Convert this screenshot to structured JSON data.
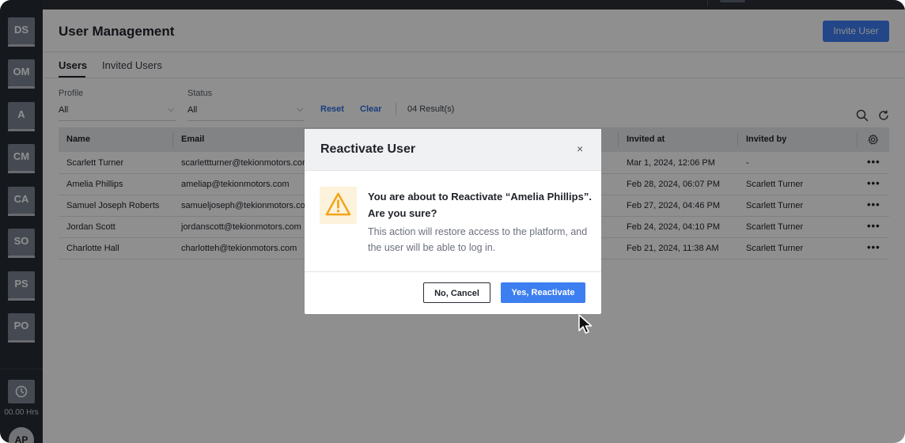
{
  "sidebar": {
    "items": [
      {
        "label": "DS"
      },
      {
        "label": "OM"
      },
      {
        "label": "A"
      },
      {
        "label": "CM"
      },
      {
        "label": "CA"
      },
      {
        "label": "SO"
      },
      {
        "label": "PS"
      },
      {
        "label": "PO"
      }
    ],
    "timer_label": "00.00 Hrs",
    "avatar_label": "AP"
  },
  "header": {
    "title": "User Management",
    "invite_button": "Invite User"
  },
  "tabs": [
    {
      "label": "Users",
      "active": true
    },
    {
      "label": "Invited Users",
      "active": false
    }
  ],
  "filters": {
    "profile": {
      "label": "Profile",
      "value": "All"
    },
    "status": {
      "label": "Status",
      "value": "All"
    },
    "reset": "Reset",
    "clear": "Clear",
    "results": "04 Result(s)"
  },
  "table": {
    "columns": [
      "Name",
      "Email",
      "Invited at",
      "Invited by"
    ],
    "rows": [
      {
        "name": "Scarlett Turner",
        "email": "scarlettturner@tekionmotors.com",
        "invited_at": "Mar 1, 2024, 12:06 PM",
        "invited_by": "-"
      },
      {
        "name": "Amelia Phillips",
        "email": "ameliap@tekionmotors.com",
        "invited_at": "Feb 28, 2024, 06:07 PM",
        "invited_by": "Scarlett Turner"
      },
      {
        "name": "Samuel Joseph Roberts",
        "email": "samueljoseph@tekionmotors.com",
        "invited_at": "Feb 27, 2024, 04:46 PM",
        "invited_by": "Scarlett Turner"
      },
      {
        "name": "Jordan Scott",
        "email": "jordanscott@tekionmotors.com",
        "invited_at": "Feb 24, 2024, 04:10 PM",
        "invited_by": "Scarlett Turner"
      },
      {
        "name": "Charlotte Hall",
        "email": "charlotteh@tekionmotors.com",
        "invited_at": "Feb 21, 2024, 11:38 AM",
        "invited_by": "Scarlett Turner"
      }
    ],
    "row_menu": "•••"
  },
  "modal": {
    "title": "Reactivate User",
    "close": "×",
    "message": "You are about to Reactivate “Amelia Phillips”. Are you sure?",
    "description": "This action will restore access to the platform, and the user will be able to log in.",
    "cancel_button": "No, Cancel",
    "confirm_button": "Yes, Reactivate"
  },
  "colors": {
    "accent": "#3d7ef0",
    "sidebar": "#262b34",
    "warning": "#f2a51a"
  }
}
